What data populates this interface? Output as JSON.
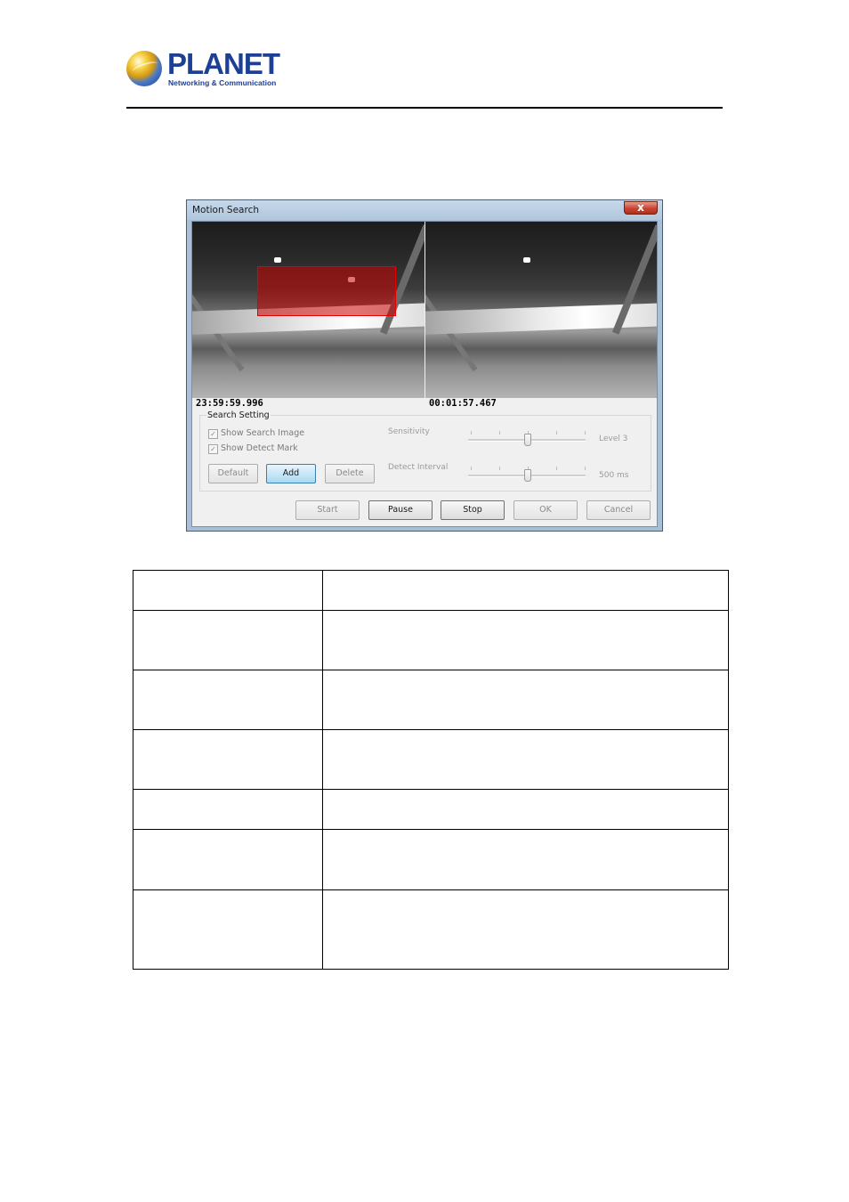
{
  "brand": {
    "name": "PLANET",
    "tagline": "Networking & Communication"
  },
  "window": {
    "title": "Motion Search",
    "close_glyph": "x"
  },
  "video": {
    "left_timestamp": "23:59:59.996",
    "right_timestamp": "00:01:57.467"
  },
  "search_setting": {
    "title": "Search Setting",
    "show_search_image": {
      "label": "Show Search Image",
      "checked": true,
      "enabled": false
    },
    "show_detect_mark": {
      "label": "Show Detect Mark",
      "checked": true,
      "enabled": false
    },
    "buttons": {
      "default": "Default",
      "add": "Add",
      "delete": "Delete"
    },
    "sensitivity": {
      "label": "Sensitivity",
      "value": "Level 3",
      "level": 3,
      "max_level": 5
    },
    "detect_interval": {
      "label": "Detect Interval",
      "value": "500 ms"
    }
  },
  "footer_buttons": {
    "start": "Start",
    "pause": "Pause",
    "stop": "Stop",
    "ok": "OK",
    "cancel": "Cancel"
  },
  "colors": {
    "brand_blue": "#1d3f94",
    "roi_red": "#c80000",
    "add_button_highlight": "#a9d9f2"
  },
  "description_table": {
    "rows": [
      {
        "name": "",
        "description": ""
      },
      {
        "name": "",
        "description": ""
      },
      {
        "name": "",
        "description": ""
      },
      {
        "name": "",
        "description": ""
      },
      {
        "name": "",
        "description": ""
      },
      {
        "name": "",
        "description": ""
      },
      {
        "name": "",
        "description": ""
      }
    ]
  }
}
